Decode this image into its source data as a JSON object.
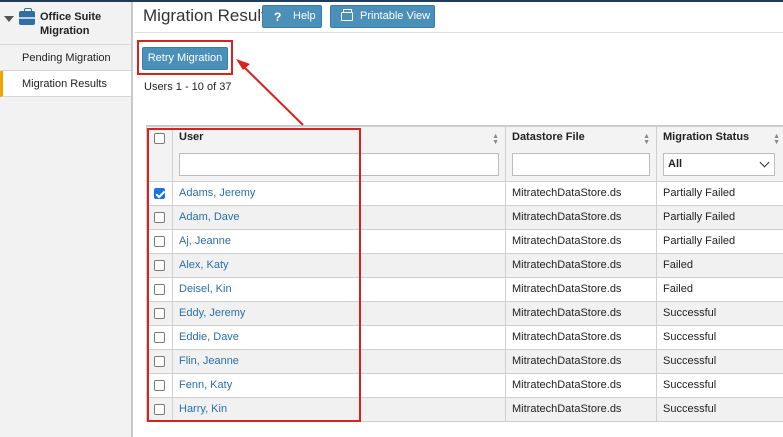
{
  "sidebar": {
    "section_title": "Office Suite Migration",
    "items": [
      {
        "label": "Pending Migration"
      },
      {
        "label": "Migration Results"
      }
    ]
  },
  "header": {
    "title": "Migration Results",
    "help_label": "Help",
    "help_icon_glyph": "?",
    "print_label": "Printable View"
  },
  "actions": {
    "retry_label": "Retry Migration"
  },
  "pagination": {
    "summary": "Users 1 - 10 of 37"
  },
  "table": {
    "columns": [
      {
        "label": "User"
      },
      {
        "label": "Datastore File"
      },
      {
        "label": "Migration Status"
      }
    ],
    "status_filter": "All",
    "rows": [
      {
        "user": "Adams, Jeremy",
        "file": "MitratechDataStore.ds",
        "status": "Partially Failed",
        "checked": true
      },
      {
        "user": "Adam, Dave",
        "file": "MitratechDataStore.ds",
        "status": "Partially Failed",
        "checked": false
      },
      {
        "user": "Aj, Jeanne",
        "file": "MitratechDataStore.ds",
        "status": "Partially Failed",
        "checked": false
      },
      {
        "user": "Alex, Katy",
        "file": "MitratechDataStore.ds",
        "status": "Failed",
        "checked": false
      },
      {
        "user": "Deisel, Kin",
        "file": "MitratechDataStore.ds",
        "status": "Failed",
        "checked": false
      },
      {
        "user": "Eddy, Jeremy",
        "file": "MitratechDataStore.ds",
        "status": "Successful",
        "checked": false
      },
      {
        "user": "Eddie, Dave",
        "file": "MitratechDataStore.ds",
        "status": "Successful",
        "checked": false
      },
      {
        "user": "Flin, Jeanne",
        "file": "MitratechDataStore.ds",
        "status": "Successful",
        "checked": false
      },
      {
        "user": "Fenn, Katy",
        "file": "MitratechDataStore.ds",
        "status": "Successful",
        "checked": false
      },
      {
        "user": "Harry, Kin",
        "file": "MitratechDataStore.ds",
        "status": "Successful",
        "checked": false
      }
    ]
  },
  "colors": {
    "accent_button": "#4a90b8",
    "highlight": "#d9221f",
    "link": "#2a6fa8",
    "active_marker": "#f0a500"
  }
}
